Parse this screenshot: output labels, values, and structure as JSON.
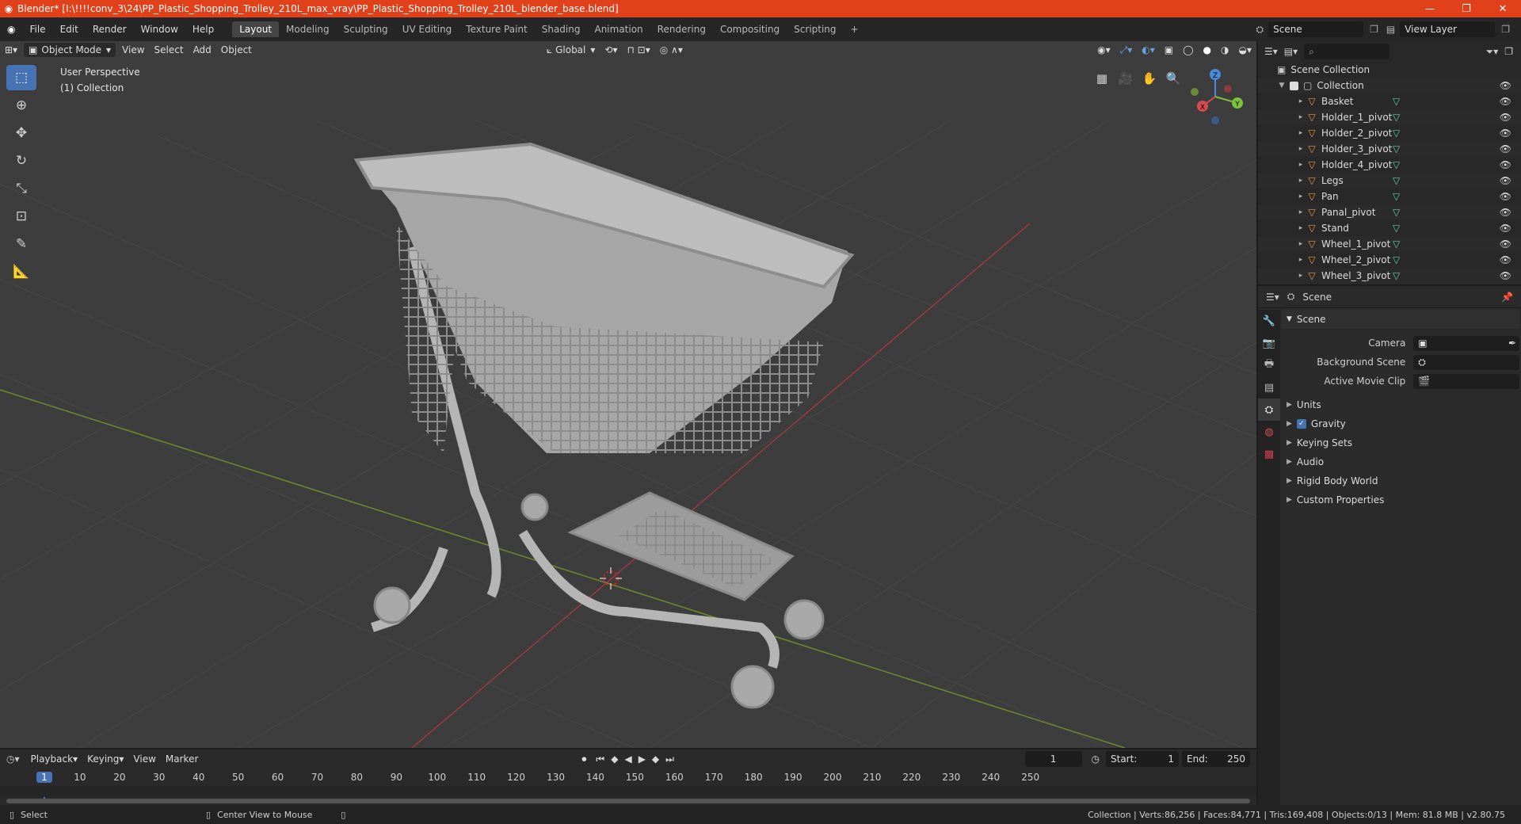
{
  "titlebar": {
    "title": "Blender* [I:\\!!!!conv_3\\24\\PP_Plastic_Shopping_Trolley_210L_max_vray\\PP_Plastic_Shopping_Trolley_210L_blender_base.blend]",
    "minimize": "—",
    "maximize": "❐",
    "close": "✕"
  },
  "menus": [
    "File",
    "Edit",
    "Render",
    "Window",
    "Help"
  ],
  "workspaces": [
    "Layout",
    "Modeling",
    "Sculpting",
    "UV Editing",
    "Texture Paint",
    "Shading",
    "Animation",
    "Rendering",
    "Compositing",
    "Scripting"
  ],
  "workspace_active": "Layout",
  "scene_field": "Scene",
  "view_layer_field": "View Layer",
  "viewport": {
    "mode": "Object Mode",
    "menus": [
      "View",
      "Select",
      "Add",
      "Object"
    ],
    "transform_orientation": "Global",
    "perspective_label": "User Perspective",
    "collection_label": "(1) Collection",
    "gizmo_axes": {
      "x": "X",
      "y": "Y",
      "z": "Z"
    }
  },
  "outliner": {
    "search_placeholder": "",
    "root": "Scene Collection",
    "collection": "Collection",
    "objects": [
      "Basket",
      "Holder_1_pivot",
      "Holder_2_pivot",
      "Holder_3_pivot",
      "Holder_4_pivot",
      "Legs",
      "Pan",
      "Panal_pivot",
      "Stand",
      "Wheel_1_pivot",
      "Wheel_2_pivot",
      "Wheel_3_pivot"
    ]
  },
  "properties": {
    "context": "Scene",
    "panel_title": "Scene",
    "fields": [
      {
        "label": "Camera",
        "value": ""
      },
      {
        "label": "Background Scene",
        "value": ""
      },
      {
        "label": "Active Movie Clip",
        "value": ""
      }
    ],
    "subpanels": [
      "Units",
      "Gravity",
      "Keying Sets",
      "Audio",
      "Rigid Body World",
      "Custom Properties"
    ],
    "gravity_checked": true
  },
  "timeline": {
    "menus": [
      "Playback",
      "Keying",
      "View",
      "Marker"
    ],
    "current_frame": "1",
    "start_label": "Start:",
    "start": "1",
    "end_label": "End:",
    "end": "250",
    "ruler": [
      "1",
      "10",
      "20",
      "30",
      "40",
      "50",
      "60",
      "70",
      "80",
      "90",
      "100",
      "110",
      "120",
      "130",
      "140",
      "150",
      "160",
      "170",
      "180",
      "190",
      "200",
      "210",
      "220",
      "230",
      "240",
      "250"
    ]
  },
  "statusbar": {
    "left_action": "Select",
    "middle_action": "Center View to Mouse",
    "stats": "Collection | Verts:86,256 | Faces:84,771 | Tris:169,408 | Objects:0/13 | Mem: 81.8 MB | v2.80.75"
  }
}
